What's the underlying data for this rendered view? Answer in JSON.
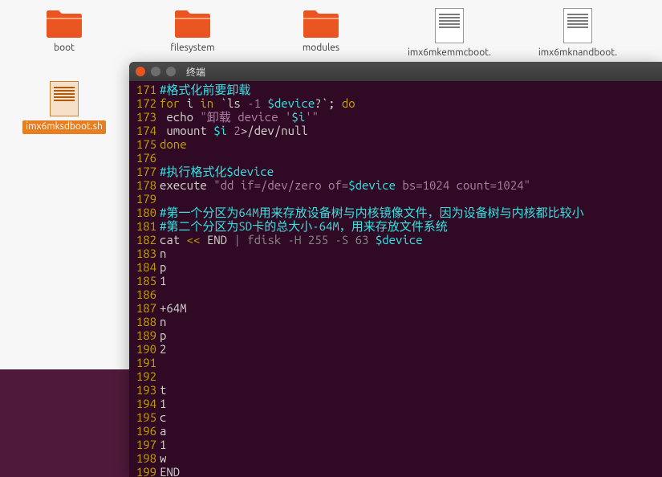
{
  "desktop": {
    "row1": [
      {
        "type": "folder",
        "label": "boot"
      },
      {
        "type": "folder",
        "label": "filesystem"
      },
      {
        "type": "folder",
        "label": "modules"
      },
      {
        "type": "script",
        "label": "imx6mkemmcboot."
      },
      {
        "type": "script",
        "label": "imx6mknandboot."
      }
    ],
    "row2": [
      {
        "type": "script-orange",
        "label": "imx6mksdboot.sh",
        "selected": true
      }
    ]
  },
  "terminal": {
    "title": "终端",
    "lines": [
      {
        "n": "171",
        "segs": [
          {
            "c": "c-comment",
            "t": "#格式化前要卸载"
          }
        ]
      },
      {
        "n": "172",
        "segs": [
          {
            "c": "c-kw",
            "t": "for"
          },
          {
            "c": "c-def",
            "t": " i "
          },
          {
            "c": "c-kw",
            "t": "in"
          },
          {
            "c": "c-def",
            "t": " `ls "
          },
          {
            "c": "c-num",
            "t": "-1"
          },
          {
            "c": "c-def",
            "t": " "
          },
          {
            "c": "c-var",
            "t": "$device"
          },
          {
            "c": "c-def",
            "t": "?`; "
          },
          {
            "c": "c-kw",
            "t": "do"
          }
        ]
      },
      {
        "n": "173",
        "segs": [
          {
            "c": "c-def",
            "t": " echo "
          },
          {
            "c": "c-str",
            "t": "\"卸载 device '"
          },
          {
            "c": "c-var",
            "t": "$i"
          },
          {
            "c": "c-str",
            "t": "'\""
          }
        ]
      },
      {
        "n": "174",
        "segs": [
          {
            "c": "c-def",
            "t": " umount "
          },
          {
            "c": "c-var",
            "t": "$i"
          },
          {
            "c": "c-def",
            "t": " "
          },
          {
            "c": "c-num",
            "t": "2"
          },
          {
            "c": "c-def",
            "t": ">/dev/null"
          }
        ]
      },
      {
        "n": "175",
        "segs": [
          {
            "c": "c-kw",
            "t": "done"
          }
        ]
      },
      {
        "n": "176",
        "segs": [
          {
            "c": "c-def",
            "t": ""
          }
        ]
      },
      {
        "n": "177",
        "segs": [
          {
            "c": "c-comment",
            "t": "#执行格式化$device"
          }
        ]
      },
      {
        "n": "178",
        "segs": [
          {
            "c": "c-def",
            "t": "execute "
          },
          {
            "c": "c-str",
            "t": "\"dd if=/dev/zero of="
          },
          {
            "c": "c-var",
            "t": "$device"
          },
          {
            "c": "c-str",
            "t": " bs=1024 count=1024\""
          }
        ]
      },
      {
        "n": "179",
        "segs": [
          {
            "c": "c-def",
            "t": ""
          }
        ]
      },
      {
        "n": "180",
        "segs": [
          {
            "c": "c-comment",
            "t": "#第一个分区为64M用来存放设备树与内核镜像文件，因为设备树与内核都比较小"
          }
        ]
      },
      {
        "n": "181",
        "segs": [
          {
            "c": "c-comment",
            "t": "#第二个分区为SD卡的总大小-64M，用来存放文件系统"
          }
        ]
      },
      {
        "n": "182",
        "segs": [
          {
            "c": "c-def",
            "t": "cat "
          },
          {
            "c": "c-kw",
            "t": "<<"
          },
          {
            "c": "c-def",
            "t": " END "
          },
          {
            "c": "c-dull",
            "t": "| fdisk -H 255 -S 63 "
          },
          {
            "c": "c-var",
            "t": "$device"
          }
        ]
      },
      {
        "n": "183",
        "segs": [
          {
            "c": "c-def",
            "t": "n"
          }
        ]
      },
      {
        "n": "184",
        "segs": [
          {
            "c": "c-def",
            "t": "p"
          }
        ]
      },
      {
        "n": "185",
        "segs": [
          {
            "c": "c-def",
            "t": "1"
          }
        ]
      },
      {
        "n": "186",
        "segs": [
          {
            "c": "c-def",
            "t": ""
          }
        ]
      },
      {
        "n": "187",
        "segs": [
          {
            "c": "c-def",
            "t": "+64M"
          }
        ]
      },
      {
        "n": "188",
        "segs": [
          {
            "c": "c-def",
            "t": "n"
          }
        ]
      },
      {
        "n": "189",
        "segs": [
          {
            "c": "c-def",
            "t": "p"
          }
        ]
      },
      {
        "n": "190",
        "segs": [
          {
            "c": "c-def",
            "t": "2"
          }
        ]
      },
      {
        "n": "191",
        "segs": [
          {
            "c": "c-def",
            "t": ""
          }
        ]
      },
      {
        "n": "192",
        "segs": [
          {
            "c": "c-def",
            "t": ""
          }
        ]
      },
      {
        "n": "193",
        "segs": [
          {
            "c": "c-def",
            "t": "t"
          }
        ]
      },
      {
        "n": "194",
        "segs": [
          {
            "c": "c-def",
            "t": "1"
          }
        ]
      },
      {
        "n": "195",
        "segs": [
          {
            "c": "c-def",
            "t": "c"
          }
        ]
      },
      {
        "n": "196",
        "segs": [
          {
            "c": "c-def",
            "t": "a"
          }
        ]
      },
      {
        "n": "197",
        "segs": [
          {
            "c": "c-def",
            "t": "1"
          }
        ]
      },
      {
        "n": "198",
        "segs": [
          {
            "c": "c-def",
            "t": "w"
          }
        ]
      },
      {
        "n": "199",
        "segs": [
          {
            "c": "c-def",
            "t": "END"
          }
        ]
      }
    ]
  }
}
